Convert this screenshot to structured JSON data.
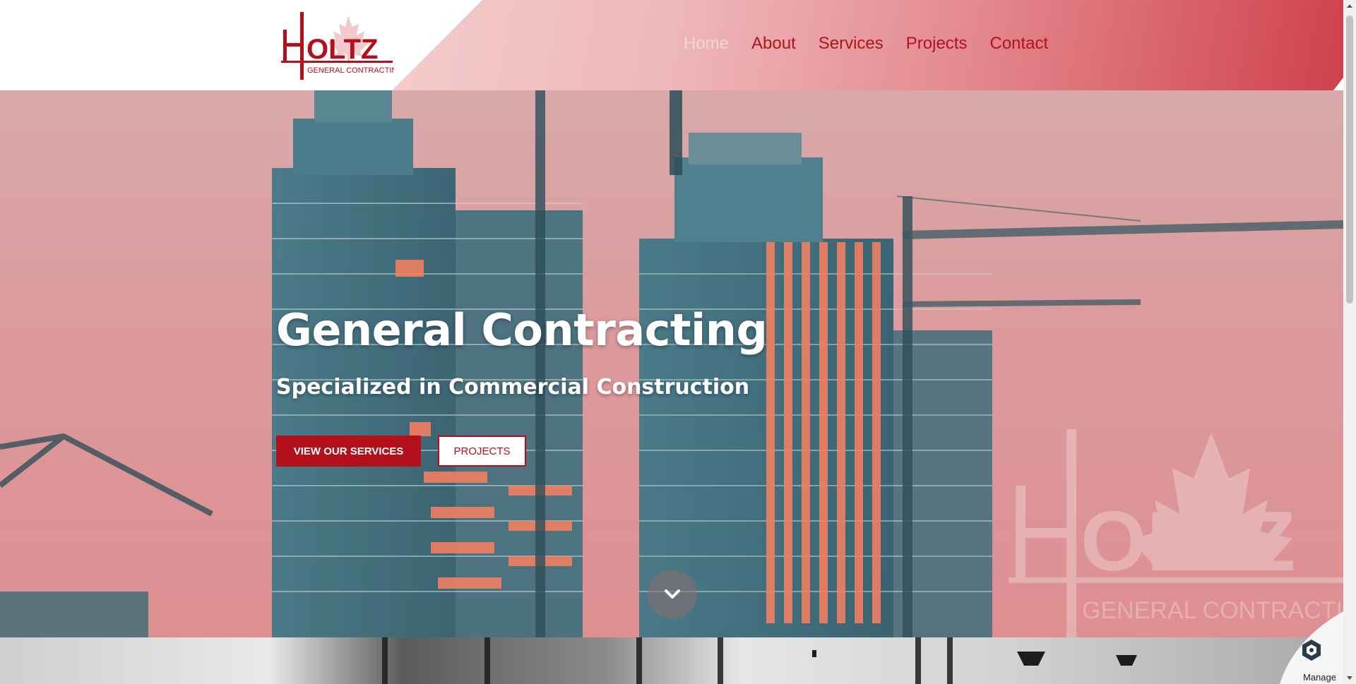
{
  "brand": {
    "logo_wordmark": "HOLTZ",
    "logo_tagline": "GENERAL CONTRACTING",
    "color_primary": "#b3101b"
  },
  "nav": {
    "items": [
      {
        "label": "Home",
        "active": true
      },
      {
        "label": "About",
        "active": false
      },
      {
        "label": "Services",
        "active": false
      },
      {
        "label": "Projects",
        "active": false
      },
      {
        "label": "Contact",
        "active": false
      }
    ]
  },
  "hero": {
    "title": "General Contracting",
    "subtitle": "Specialized in Commercial Construction",
    "primary_button": "VIEW OUR SERVICES",
    "secondary_button": "PROJECTS",
    "scroll_icon": "chevron-down-icon",
    "watermark_wordmark": "HOLTZ",
    "watermark_tagline": "GENERAL CONTRACTING"
  },
  "cookie_widget": {
    "label": "Manage",
    "icon": "shield-logo-icon"
  }
}
